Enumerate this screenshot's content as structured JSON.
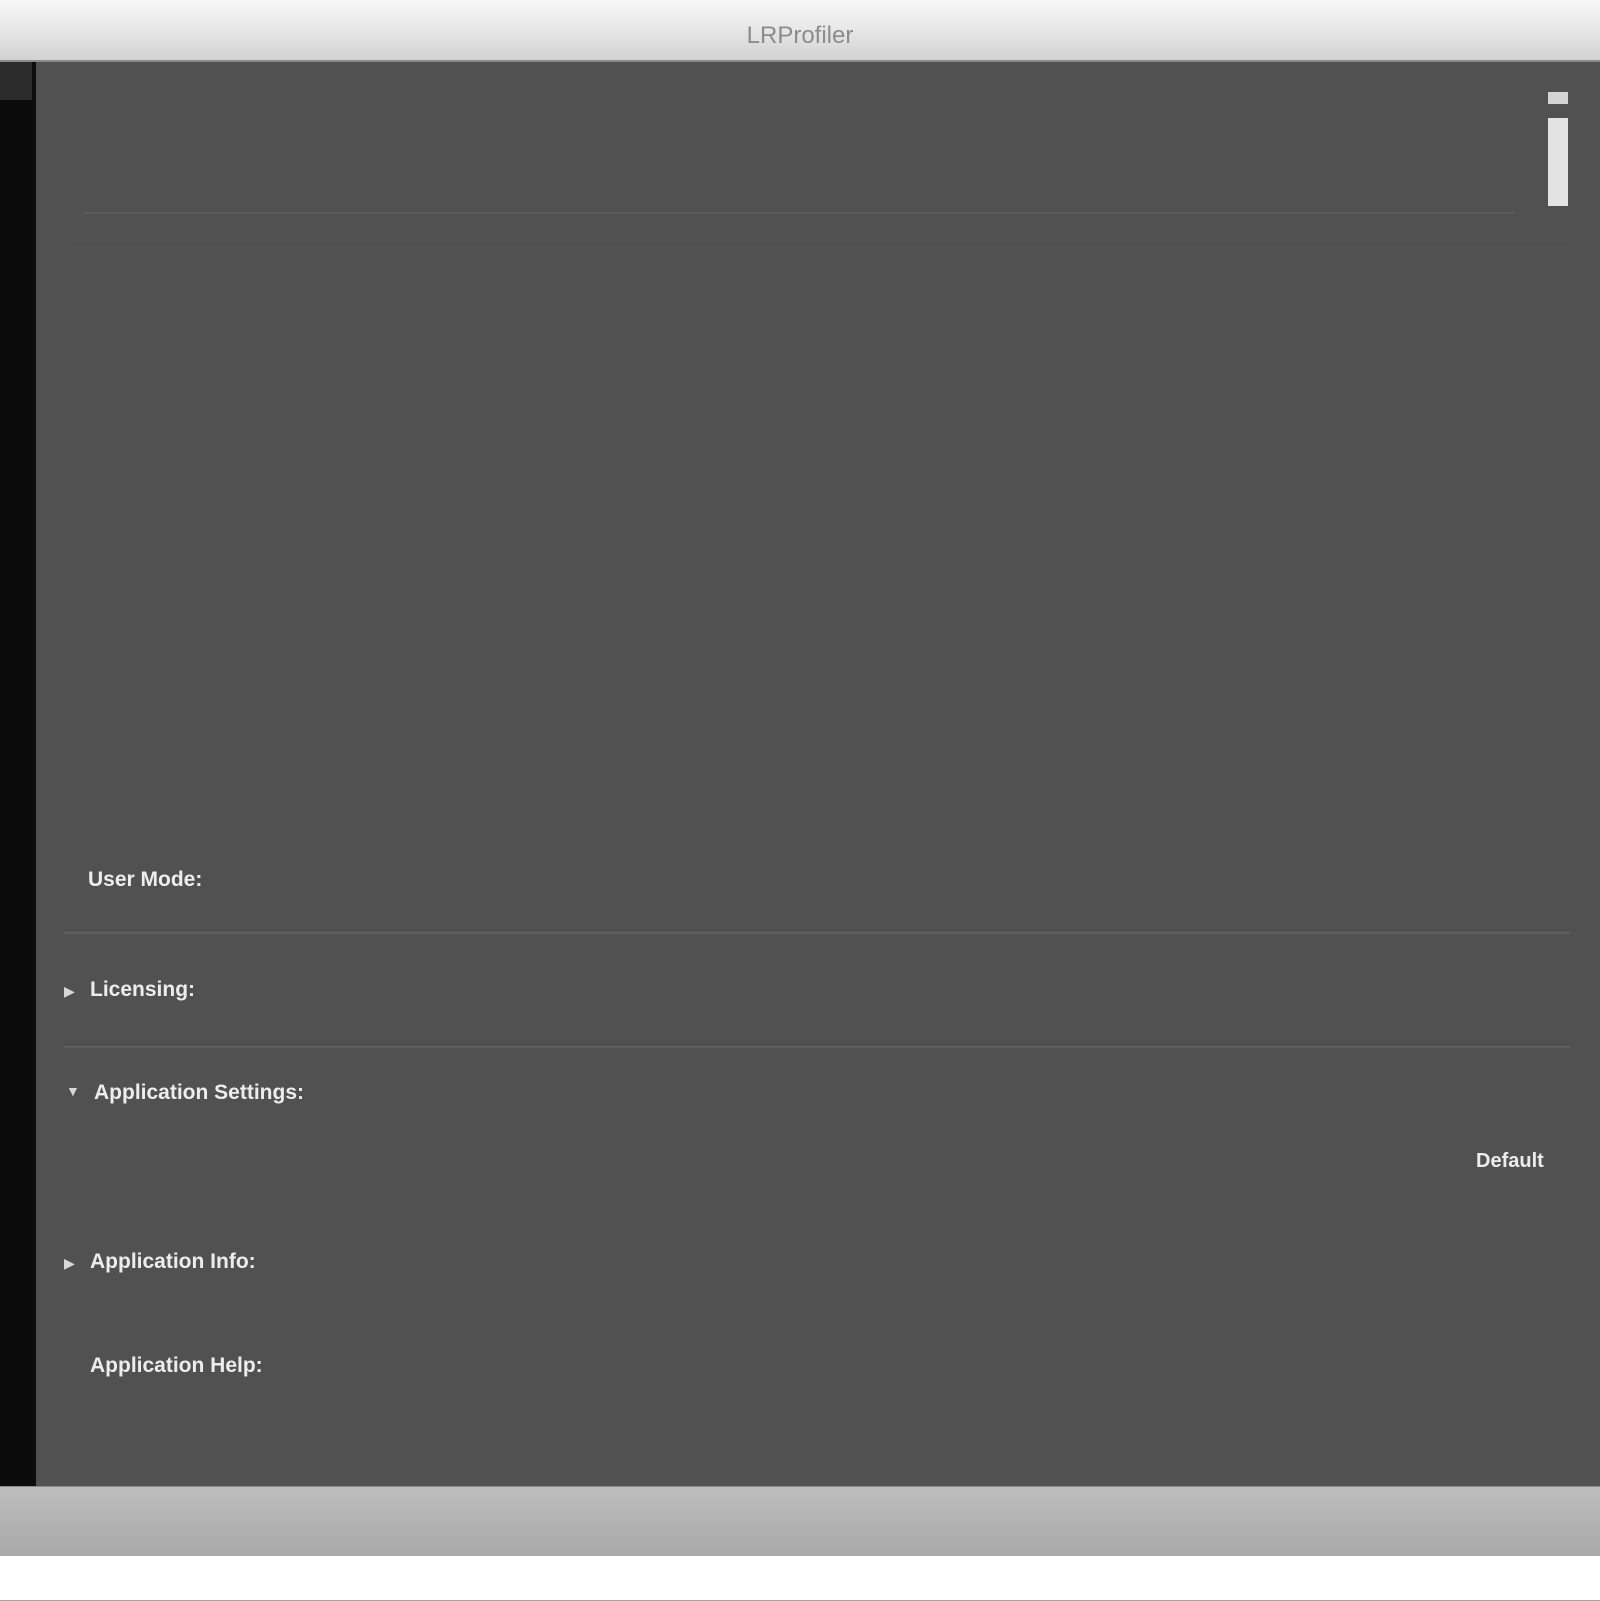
{
  "window": {
    "title": "LRProfiler"
  },
  "sections": {
    "user_mode": {
      "label": "User Mode:"
    },
    "licensing": {
      "label": "Licensing:",
      "expanded": false
    },
    "application_settings": {
      "label": "Application Settings:",
      "expanded": true,
      "partial_right_label": "Default"
    },
    "application_info": {
      "label": "Application Info:",
      "expanded": false
    },
    "application_help": {
      "label": "Application Help:"
    }
  },
  "icons": {
    "collapsed": "disclosure-triangle-right",
    "expanded": "disclosure-triangle-down"
  },
  "colors": {
    "panel": "#515151",
    "text": "#ededed",
    "sidebar": "#0b0b0b"
  }
}
